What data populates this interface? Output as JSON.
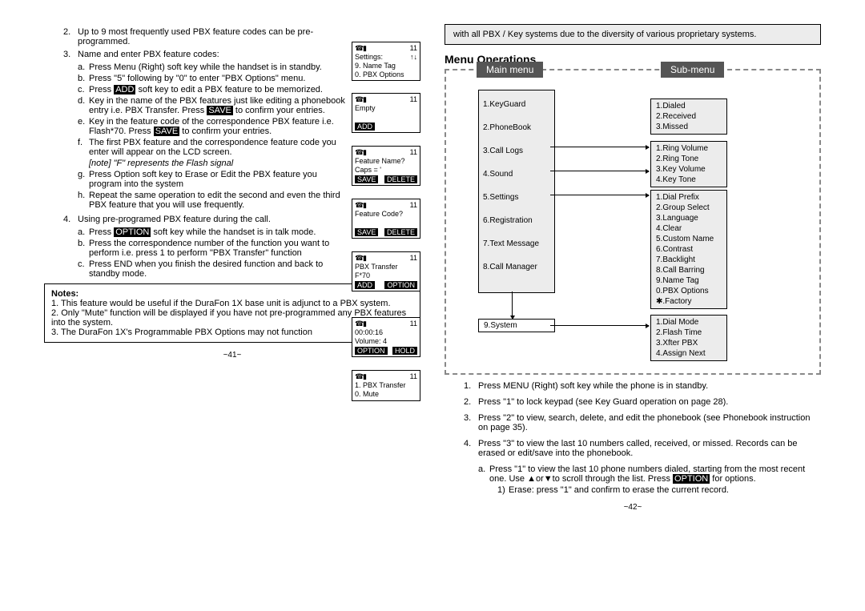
{
  "left": {
    "l2": "Up to 9 most frequently used PBX feature codes can be pre-programmed.",
    "l3": "Name and enter PBX feature codes:",
    "l3a": "Press Menu (Right) soft key while the handset is in standby.",
    "l3b": "Press \"5\"  following by \"0\" to enter \"PBX Options\" menu.",
    "l3c_pre": "Press ",
    "l3c_k": "ADD",
    "l3c_suf": " soft key to edit a PBX feature to be memorized.",
    "l3d_pre": "Key in the name of the PBX features just like editing a phonebook entry i.e. PBX Transfer.  Press ",
    "l3d_k": "SAVE",
    "l3d_suf": " to confirm your entries.",
    "l3e_pre": "Key in the feature code of the correspondence PBX feature i.e. Flash*70. Press ",
    "l3e_k": "SAVE",
    "l3e_suf": " to confirm your entries.",
    "l3f": "The first PBX feature and the correspondence feature code you enter will appear on the LCD screen.",
    "l3note": "[note] \"F\" represents the Flash signal",
    "l3g": " Press Option soft key to Erase or Edit the PBX feature you program into the system",
    "l3h": "Repeat the same operation to edit the second and even the third PBX feature that you will use frequently.",
    "l4": "Using pre-programed PBX feature during the call.",
    "l4a_pre": "Press ",
    "l4a_k": "OPTION",
    "l4a_suf": " soft key while the handset is in talk mode.",
    "l4b": "Press the correspondence number of the function you want to perform i.e. press 1 to perform \"PBX Transfer\" function",
    "l4c": "Press END when you finish the desired function and back to standby mode.",
    "notes_hd": "Notes:",
    "notes_1": "1. This feature would be useful if the DuraFon 1X base unit is adjunct to a PBX system.",
    "notes_2": "2. Only \"Mute\" function will be displayed if you have not pre-programmed any PBX features into the system.",
    "notes_3": "3. The DuraFon 1X's Programmable PBX Options may not function",
    "pg": "~41~"
  },
  "scr": {
    "bat": "11",
    "s1a": "Settings:",
    "s1b": "9. Name Tag",
    "s1c": "0. PBX Options",
    "s2a": "Empty",
    "s2k": "ADD",
    "s3a": "Feature Name?",
    "s3b": "Caps = '",
    "s3k1": "SAVE",
    "s3k2": "DELETE",
    "s4a": "Feature Code?",
    "s4k1": "SAVE",
    "s4k2": "DELETE",
    "s5a": "PBX Transfer",
    "s5b": "F*70",
    "s5k1": "ADD",
    "s5k2": "OPTION",
    "s6a": "00:00:16",
    "s6b": "Volume: 4",
    "s6k1": "OPTION",
    "s6k2": "HOLD",
    "s7a": "1. PBX Transfer",
    "s7b": "0. Mute"
  },
  "right": {
    "warn": "with all PBX / Key systems due to the diversity of various proprietary systems.",
    "title": "Menu Operations",
    "main_lbl": "Main menu",
    "sub_lbl": "Sub-menu",
    "m1": "1.KeyGuard",
    "m2": "2.PhoneBook",
    "m3": "3.Call Logs",
    "m4": "4.Sound",
    "m5": "5.Settings",
    "m6": "6.Registration",
    "m7": "7.Text Message",
    "m8": "8.Call Manager",
    "m9": "9.System",
    "sA": "1.Dialed\n2.Received\n3.Missed",
    "sB": "1.Ring Volume\n2.Ring Tone\n3.Key Volume\n4.Key Tone",
    "sC": "1.Dial Prefix\n2.Group Select\n3.Language\n4.Clear\n5.Custom Name\n6.Contrast\n7.Backlight\n8.Call Barring\n9.Name Tag\n0.PBX Options\n✱.Factory",
    "sD": "1.Dial Mode\n2.Flash Time\n3.Xfter PBX\n4.Assign Next",
    "r1": "Press MENU (Right) soft key while the phone is in standby.",
    "r2": "Press \"1\" to lock keypad (see Key Guard operation on page 28).",
    "r3": "Press \"2\" to view, search, delete, and edit the phonebook (see Phonebook instruction on page 35).",
    "r4": "Press \"3\" to view the last 10 numbers called, received, or missed. Records can be erased or edit/save into the phonebook.",
    "r4a_pre": "Press \"1\" to view the last 10 phone numbers dialed, starting from the most recent one.  Use ▲or▼to scroll through the list. Press ",
    "r4a_k": "OPTION",
    "r4a_suf": " for options.",
    "r4a1": "Erase: press \"1\" and confirm to erase the current record.",
    "pg": "~42~"
  }
}
